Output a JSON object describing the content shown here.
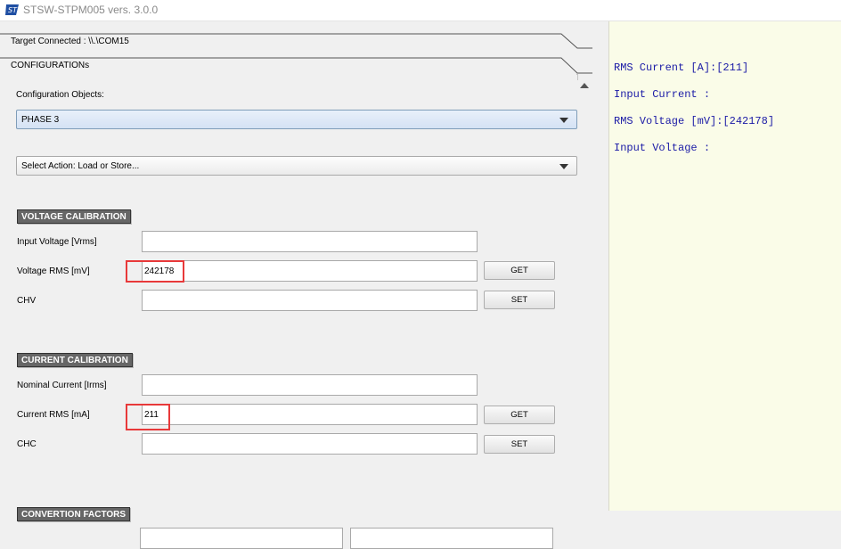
{
  "window": {
    "title": "STSW-STPM005 vers. 3.0.0"
  },
  "headers": {
    "connection": "Target Connected : \\\\.\\COM15",
    "configurations": "CONFIGURATIONs"
  },
  "config": {
    "objects_label": "Configuration Objects:",
    "objects_selected": "PHASE 3",
    "action_selected": "Select Action: Load or Store..."
  },
  "voltage": {
    "title": "VOLTAGE CALIBRATION",
    "input_label": "Input Voltage [Vrms]",
    "input_value": "",
    "rms_label": "Voltage RMS [mV]",
    "rms_value": "242178",
    "chv_label": "CHV",
    "chv_value": "",
    "get_label": "GET",
    "set_label": "SET"
  },
  "current": {
    "title": "CURRENT CALIBRATION",
    "nominal_label": "Nominal Current [Irms]",
    "nominal_value": "",
    "rms_label": "Current RMS [mA]",
    "rms_value": "211",
    "chc_label": "CHC",
    "chc_value": "",
    "get_label": "GET",
    "set_label": "SET"
  },
  "conversion": {
    "title": "CONVERTION FACTORS"
  },
  "console": {
    "lines": [
      "RMS Current [A]:[211]",
      "Input Current :",
      "RMS Voltage [mV]:[242178]",
      "Input Voltage :"
    ]
  },
  "colors": {
    "console_text": "#1a1aa6",
    "console_bg": "#fafce8",
    "highlight": "#e8393a",
    "section_bg": "#666666"
  }
}
